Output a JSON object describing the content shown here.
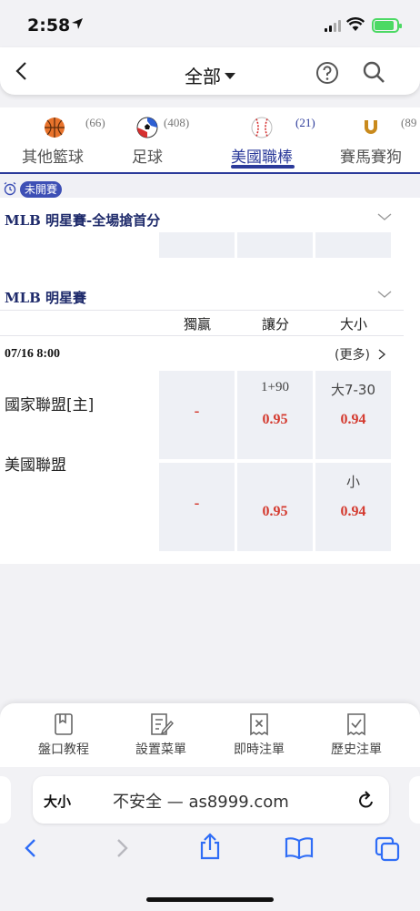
{
  "status_bar": {
    "time": "2:58"
  },
  "header": {
    "title": "全部"
  },
  "sport_tabs": [
    {
      "label": "其他籃球",
      "count": "(66)",
      "icon": "basketball-icon",
      "active": false
    },
    {
      "label": "足球",
      "count": "(408)",
      "icon": "soccer-ball-icon",
      "active": false
    },
    {
      "label": "美國職棒",
      "count": "(21)",
      "icon": "baseball-icon",
      "active": true
    },
    {
      "label": "賽馬賽狗",
      "count": "(89",
      "icon": "horseshoe-icon",
      "active": false
    }
  ],
  "status_pill": "未開賽",
  "sections": [
    {
      "title": "MLB 明星賽-全場搶首分"
    },
    {
      "title": "MLB 明星賽"
    }
  ],
  "columns": [
    "獨贏",
    "讓分",
    "大小"
  ],
  "match": {
    "datetime": "07/16  8:00",
    "more": "(更多)",
    "home": {
      "team": "國家聯盟[主]",
      "moneyline": "-",
      "handicap_line": "1+90",
      "handicap_odds": "0.95",
      "total_line": "大7-30",
      "total_odds": "0.94"
    },
    "away": {
      "team": "美國聯盟",
      "moneyline": "-",
      "handicap_line": "",
      "handicap_odds": "0.95",
      "total_line": "小",
      "total_odds": "0.94"
    }
  },
  "toolbar": [
    {
      "label": "盤口教程",
      "icon": "book-icon"
    },
    {
      "label": "設置菜單",
      "icon": "edit-menu-icon"
    },
    {
      "label": "即時注單",
      "icon": "bet-slip-icon"
    },
    {
      "label": "歷史注單",
      "icon": "history-slip-icon"
    }
  ],
  "browser": {
    "text_size": "大小",
    "url": "不安全 — as8999.com"
  },
  "colors": {
    "accent": "#2b3a9a",
    "odds": "#d43a2f",
    "pill": "#3d4fb5"
  }
}
